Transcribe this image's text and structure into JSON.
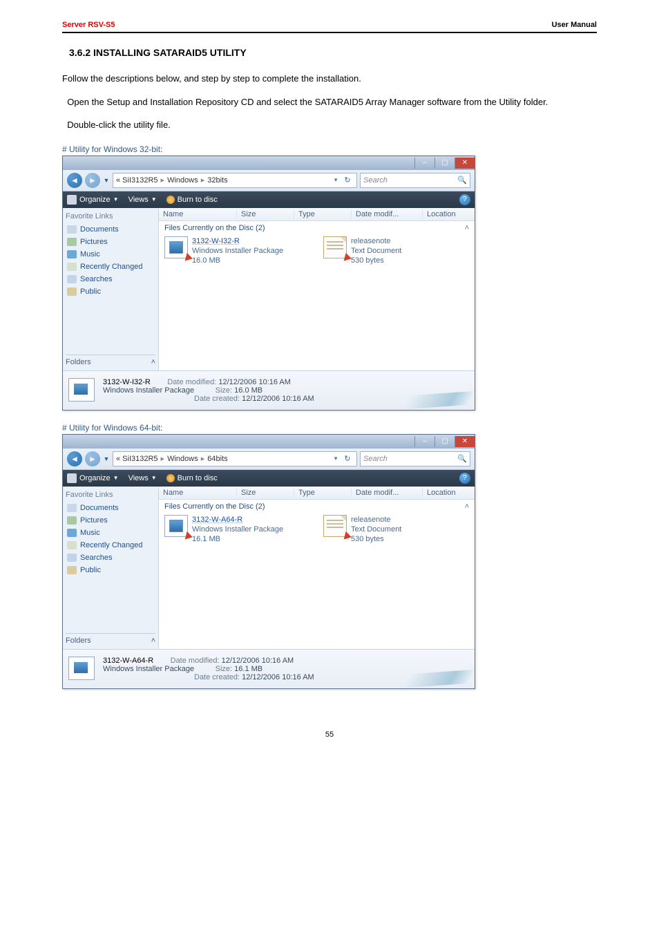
{
  "header": {
    "product_prefix": "Server",
    "product": " RSV-S5",
    "right": "User Manual"
  },
  "section": {
    "title": "3.6.2 INSTALLING SATARAID5 UTILITY"
  },
  "paragraphs": {
    "p1": "Follow the descriptions below, and step by step to complete the installation.",
    "p2": "  Open the Setup and Installation Repository CD and select the SATARAID5 Array Manager software from the Utility folder.",
    "p3": "  Double-click the utility file."
  },
  "page_number": "55",
  "caption32": "# Utility for Windows 32-bit:",
  "caption64": "# Utility for Windows 64-bit:",
  "explorer_common": {
    "breadcrumb_prefix": "«  SiI3132R5",
    "bc_sep": "▸",
    "bc_windows": "Windows",
    "toolbar": {
      "organize": "Organize",
      "views": "Views",
      "burn": "Burn to disc"
    },
    "search_placeholder": "Search",
    "sidebar": {
      "head": "Favorite Links",
      "documents": "Documents",
      "pictures": "Pictures",
      "music": "Music",
      "recent": "Recently Changed",
      "searches": "Searches",
      "public": "Public",
      "folders": "Folders"
    },
    "columns": {
      "name": "Name",
      "size": "Size",
      "type": "Type",
      "date": "Date modif...",
      "loc": "Location"
    },
    "group_header": "Files Currently on the Disc (2)",
    "file2": {
      "name": "releasenote",
      "type": "Text Document",
      "size": "530 bytes"
    },
    "details_labels": {
      "modified": "Date modified:",
      "size": "Size:",
      "created": "Date created:"
    },
    "details_values": {
      "mod": "12/12/2006 10:16 AM",
      "created": "12/12/2006 10:16 AM"
    },
    "file_type_line": "Windows Installer Package"
  },
  "explorer32": {
    "bc_last": "32bits",
    "file1": {
      "name": "3132-W-I32-R",
      "type": "Windows Installer Package",
      "size": "16.0 MB"
    },
    "details_name": "3132-W-I32-R",
    "details_size": "16.0 MB"
  },
  "explorer64": {
    "bc_last": "64bits",
    "file1": {
      "name": "3132-W-A64-R",
      "type": "Windows Installer Package",
      "size": "16.1 MB"
    },
    "details_name": "3132-W-A64-R",
    "details_size": "16.1 MB"
  }
}
